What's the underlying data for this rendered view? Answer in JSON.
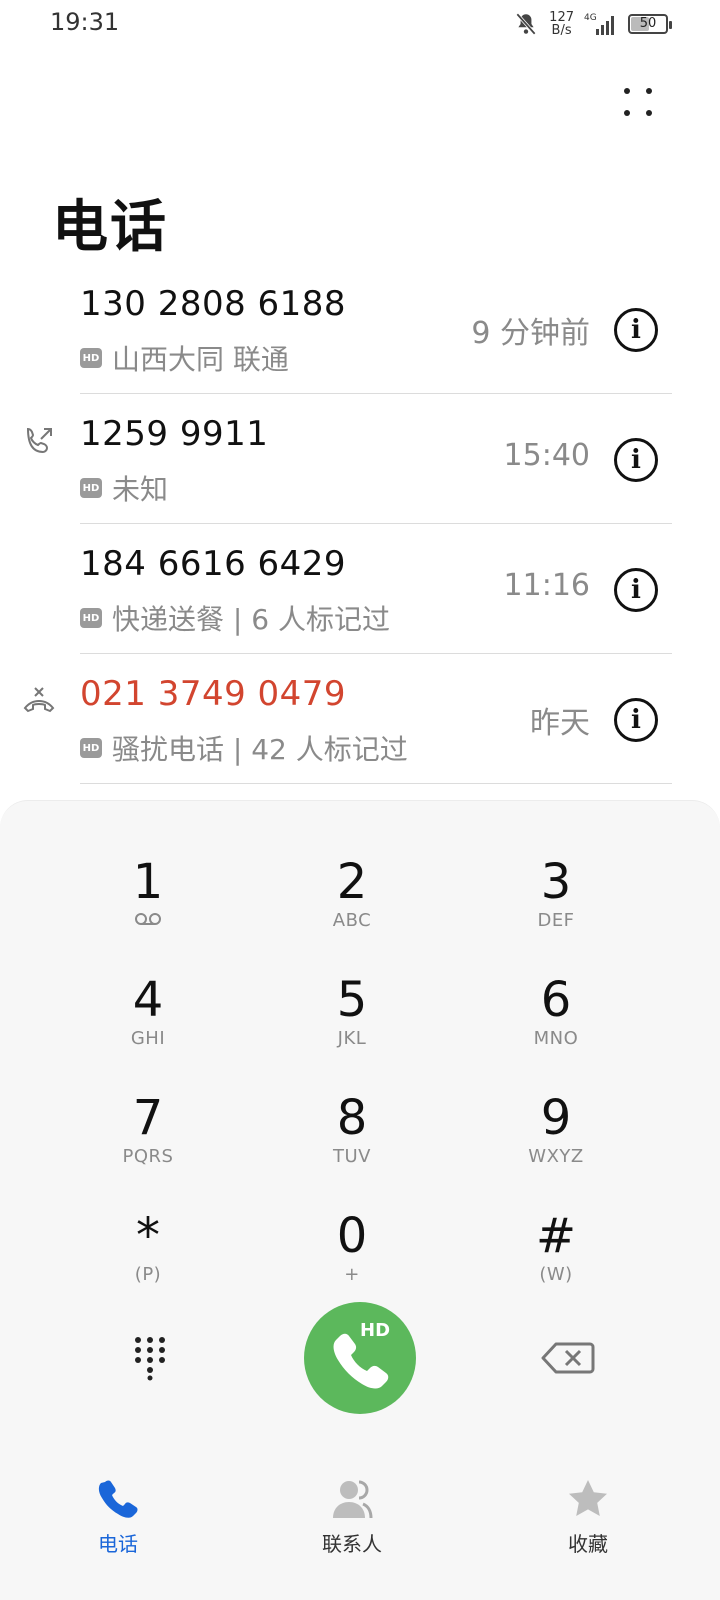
{
  "status_bar": {
    "time": "19:31",
    "net_speed_value": "127",
    "net_speed_unit": "B/s",
    "signal_label": "4G",
    "battery": "50"
  },
  "header": {
    "title": "电话"
  },
  "calls": [
    {
      "number": "130 2808 6188",
      "sub": "山西大同 联通",
      "time": "9 分钟前",
      "type": "none",
      "missed": false
    },
    {
      "number": "1259 9911",
      "sub": "未知",
      "time": "15:40",
      "type": "outgoing",
      "missed": false
    },
    {
      "number": "184 6616 6429",
      "sub": "快递送餐 | 6 人标记过",
      "time": "11:16",
      "type": "none",
      "missed": false
    },
    {
      "number": "021 3749 0479",
      "sub": "骚扰电话 | 42 人标记过",
      "time": "昨天",
      "type": "rejected",
      "missed": true
    }
  ],
  "hd_badge": "HD",
  "dialpad": {
    "keys": [
      {
        "digit": "1",
        "letters": ""
      },
      {
        "digit": "2",
        "letters": "ABC"
      },
      {
        "digit": "3",
        "letters": "DEF"
      },
      {
        "digit": "4",
        "letters": "GHI"
      },
      {
        "digit": "5",
        "letters": "JKL"
      },
      {
        "digit": "6",
        "letters": "MNO"
      },
      {
        "digit": "7",
        "letters": "PQRS"
      },
      {
        "digit": "8",
        "letters": "TUV"
      },
      {
        "digit": "9",
        "letters": "WXYZ"
      },
      {
        "digit": "*",
        "letters": "(P)"
      },
      {
        "digit": "0",
        "letters": "+"
      },
      {
        "digit": "#",
        "letters": "(W)"
      }
    ],
    "call_hd_label": "HD"
  },
  "bottom_nav": {
    "items": [
      {
        "label": "电话",
        "active": true
      },
      {
        "label": "联系人",
        "active": false
      },
      {
        "label": "收藏",
        "active": false
      }
    ]
  },
  "colors": {
    "accent": "#1a66d9",
    "call_green": "#5cb85c",
    "missed_red": "#d2452f"
  }
}
